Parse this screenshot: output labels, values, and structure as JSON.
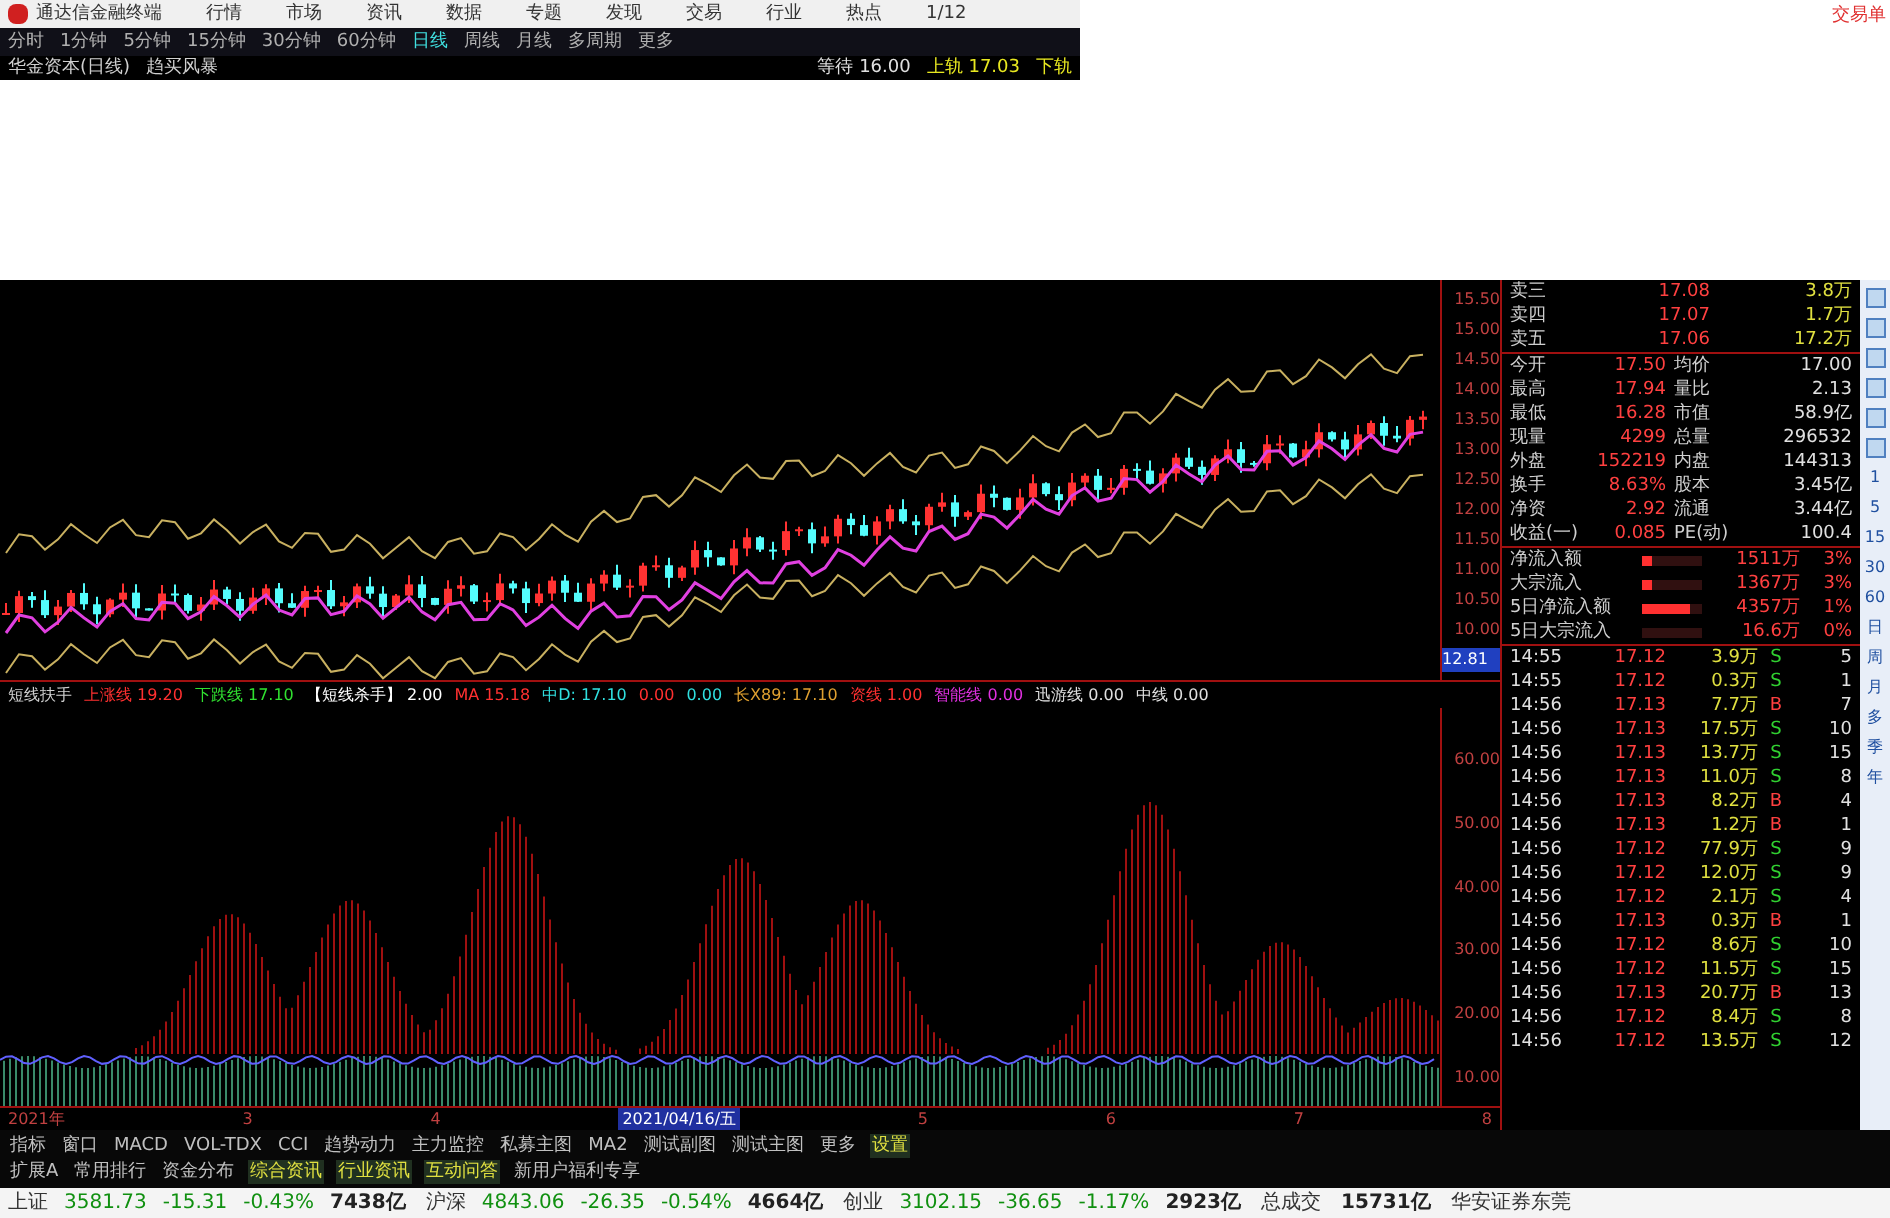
{
  "menu_bar": {
    "app_title": "通达信金融终端",
    "items": [
      "行情",
      "市场",
      "资讯",
      "数据",
      "专题",
      "发现",
      "交易",
      "行业",
      "热点",
      "1/12"
    ],
    "trade_button": "交易单"
  },
  "periods": [
    {
      "label": "分时",
      "selected": false
    },
    {
      "label": "1分钟",
      "selected": false
    },
    {
      "label": "5分钟",
      "selected": false
    },
    {
      "label": "15分钟",
      "selected": false
    },
    {
      "label": "30分钟",
      "selected": false
    },
    {
      "label": "60分钟",
      "selected": false
    },
    {
      "label": "日线",
      "selected": true
    },
    {
      "label": "周线",
      "selected": false
    },
    {
      "label": "月线",
      "selected": false
    },
    {
      "label": "多周期",
      "selected": false
    },
    {
      "label": "更多",
      "selected": false
    }
  ],
  "info_line": {
    "stock": "华金资本(日线)",
    "indicator": "趋买风暴",
    "items": [
      {
        "text": "等待 16.00",
        "color": "#e0e0e0"
      },
      {
        "text": "上轨 17.03",
        "color": "#e8e820"
      },
      {
        "text": "下轨",
        "color": "#e8e820"
      }
    ]
  },
  "price_axis": {
    "labels": [
      "15.50",
      "15.00",
      "14.50",
      "14.00",
      "13.50",
      "13.00",
      "12.50",
      "12.00",
      "11.50",
      "11.00",
      "10.50",
      "10.00"
    ],
    "current": "12.81"
  },
  "indicator": {
    "title": "短线扶手",
    "labels": [
      {
        "text": "上涨线 19.20",
        "color": "#ff3030"
      },
      {
        "text": "下跌线 17.10",
        "color": "#30e030"
      },
      {
        "text": "【短线杀手】 2.00",
        "color": "#ffffff"
      },
      {
        "text": "MA 15.18",
        "color": "#ff3030"
      },
      {
        "text": "中D: 17.10",
        "color": "#30e0e0"
      },
      {
        "text": "0.00",
        "color": "#ff3030"
      },
      {
        "text": "0.00",
        "color": "#30e0e0"
      },
      {
        "text": "长X89: 17.10",
        "color": "#e0a030"
      },
      {
        "text": "资线 1.00",
        "color": "#ff3030"
      },
      {
        "text": "智能线 0.00",
        "color": "#e030e0"
      },
      {
        "text": "迅游线 0.00",
        "color": "#e0e0e0"
      },
      {
        "text": "中线 0.00",
        "color": "#e0e0e0"
      }
    ],
    "axis": [
      "60.00",
      "50.00",
      "40.00",
      "30.00",
      "20.00",
      "10.00"
    ]
  },
  "date_axis": [
    {
      "text": "2021年",
      "selected": false
    },
    {
      "text": "3",
      "selected": false
    },
    {
      "text": "4",
      "selected": false
    },
    {
      "text": "2021/04/16/五",
      "selected": true
    },
    {
      "text": "5",
      "selected": false
    },
    {
      "text": "6",
      "selected": false
    },
    {
      "text": "7",
      "selected": false
    },
    {
      "text": "8",
      "selected": false
    }
  ],
  "tabs_row_1": [
    {
      "label": "指标",
      "selected": false
    },
    {
      "label": "窗口",
      "selected": false
    },
    {
      "label": "MACD",
      "selected": false
    },
    {
      "label": "VOL-TDX",
      "selected": false
    },
    {
      "label": "CCI",
      "selected": false
    },
    {
      "label": "趋势动力",
      "selected": false
    },
    {
      "label": "主力监控",
      "selected": false
    },
    {
      "label": "私募主图",
      "selected": false
    },
    {
      "label": "MA2",
      "selected": false
    },
    {
      "label": "测试副图",
      "selected": false
    },
    {
      "label": "测试主图",
      "selected": false
    },
    {
      "label": "更多",
      "selected": false
    },
    {
      "label": "设置",
      "selected": true
    }
  ],
  "tabs_row_2": [
    {
      "label": "扩展A",
      "selected": false
    },
    {
      "label": "常用排行",
      "selected": false
    },
    {
      "label": "资金分布",
      "selected": false
    },
    {
      "label": "综合资讯",
      "selected": true
    },
    {
      "label": "行业资讯",
      "selected": true
    },
    {
      "label": "互动问答",
      "selected": true
    },
    {
      "label": "新用户福利专享",
      "selected": false
    }
  ],
  "status_bar": {
    "indices": [
      {
        "name": "上证",
        "value": "3581.73",
        "change": "-15.31",
        "percent": "-0.43%",
        "amount": "7438亿"
      },
      {
        "name": "沪深",
        "value": "4843.06",
        "change": "-26.35",
        "percent": "-0.54%",
        "amount": "4664亿"
      },
      {
        "name": "创业",
        "value": "3102.15",
        "change": "-36.65",
        "percent": "-1.17%",
        "amount": "2923亿"
      }
    ],
    "total_label": "总成交",
    "total_value": "15731亿",
    "broker": "华安证券东莞"
  },
  "quote": {
    "asks": [
      {
        "label": "卖三",
        "price": "17.08",
        "volume": "3.8万"
      },
      {
        "label": "卖四",
        "price": "17.07",
        "volume": "1.7万"
      },
      {
        "label": "卖五",
        "price": "17.06",
        "volume": "17.2万"
      }
    ],
    "stats": [
      {
        "label": "今开",
        "value": "17.50",
        "label2": "均价",
        "value2": "17.00"
      },
      {
        "label": "最高",
        "value": "17.94",
        "label2": "量比",
        "value2": "2.13"
      },
      {
        "label": "最低",
        "value": "16.28",
        "label2": "市值",
        "value2": "58.9亿"
      },
      {
        "label": "现量",
        "value": "4299",
        "label2": "总量",
        "value2": "296532"
      },
      {
        "label": "外盘",
        "value": "152219",
        "label2": "内盘",
        "value2": "144313"
      },
      {
        "label": "换手",
        "value": "8.63%",
        "label2": "股本",
        "value2": "3.45亿"
      },
      {
        "label": "净资",
        "value": "2.92",
        "label2": "流通",
        "value2": "3.44亿"
      },
      {
        "label": "收益(一)",
        "value": "0.085",
        "label2": "PE(动)",
        "value2": "100.4"
      }
    ],
    "flows": [
      {
        "label": "净流入额",
        "level": 0.15,
        "value": "1511万",
        "percent": "3%"
      },
      {
        "label": "大宗流入",
        "level": 0.15,
        "value": "1367万",
        "percent": "3%"
      },
      {
        "label": "5日净流入额",
        "level": 0.8,
        "value": "4357万",
        "percent": "1%"
      },
      {
        "label": "5日大宗流入",
        "level": 0,
        "value": "16.6万",
        "percent": "0%"
      }
    ],
    "ticks": [
      {
        "time": "14:55",
        "price": "17.12",
        "volume": "3.9万",
        "side": "S",
        "kind": "sell",
        "count": "5"
      },
      {
        "time": "14:55",
        "price": "17.12",
        "volume": "0.3万",
        "side": "S",
        "kind": "sell",
        "count": "1"
      },
      {
        "time": "14:56",
        "price": "17.13",
        "volume": "7.7万",
        "side": "B",
        "kind": "buy",
        "count": "7"
      },
      {
        "time": "14:56",
        "price": "17.13",
        "volume": "17.5万",
        "side": "S",
        "kind": "sell",
        "count": "10"
      },
      {
        "time": "14:56",
        "price": "17.13",
        "volume": "13.7万",
        "side": "S",
        "kind": "sell",
        "count": "15"
      },
      {
        "time": "14:56",
        "price": "17.13",
        "volume": "11.0万",
        "side": "S",
        "kind": "sell",
        "count": "8"
      },
      {
        "time": "14:56",
        "price": "17.13",
        "volume": "8.2万",
        "side": "B",
        "kind": "buy",
        "count": "4"
      },
      {
        "time": "14:56",
        "price": "17.13",
        "volume": "1.2万",
        "side": "B",
        "kind": "buy",
        "count": "1"
      },
      {
        "time": "14:56",
        "price": "17.12",
        "volume": "77.9万",
        "side": "S",
        "kind": "sell",
        "count": "9"
      },
      {
        "time": "14:56",
        "price": "17.12",
        "volume": "12.0万",
        "side": "S",
        "kind": "sell",
        "count": "9"
      },
      {
        "time": "14:56",
        "price": "17.12",
        "volume": "2.1万",
        "side": "S",
        "kind": "sell",
        "count": "4"
      },
      {
        "time": "14:56",
        "price": "17.13",
        "volume": "0.3万",
        "side": "B",
        "kind": "buy",
        "count": "1"
      },
      {
        "time": "14:56",
        "price": "17.12",
        "volume": "8.6万",
        "side": "S",
        "kind": "sell",
        "count": "10"
      },
      {
        "time": "14:56",
        "price": "17.12",
        "volume": "11.5万",
        "side": "S",
        "kind": "sell",
        "count": "15"
      },
      {
        "time": "14:56",
        "price": "17.13",
        "volume": "20.7万",
        "side": "B",
        "kind": "buy",
        "count": "13"
      },
      {
        "time": "14:56",
        "price": "17.12",
        "volume": "8.4万",
        "side": "S",
        "kind": "sell",
        "count": "8"
      },
      {
        "time": "14:56",
        "price": "17.12",
        "volume": "13.5万",
        "side": "S",
        "kind": "sell",
        "count": "12"
      }
    ]
  },
  "toolbar": {
    "periods": [
      "1",
      "5",
      "15",
      "30",
      "60",
      "日",
      "周",
      "月",
      "多",
      "季",
      "年"
    ]
  }
}
